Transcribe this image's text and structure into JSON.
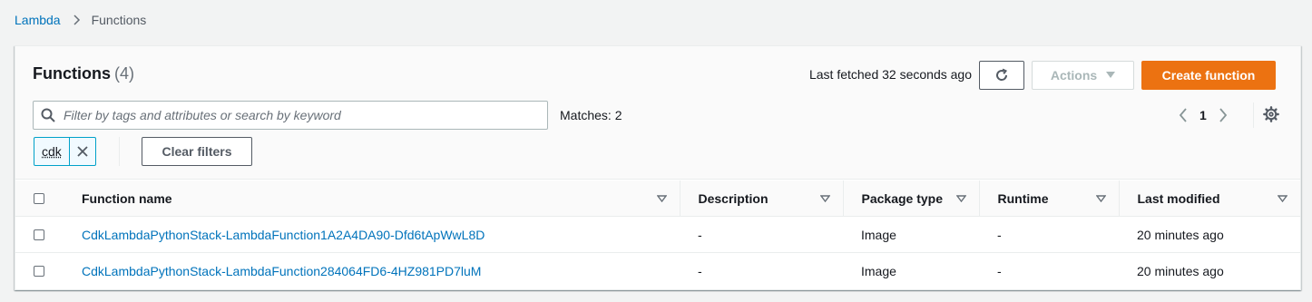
{
  "breadcrumb": {
    "root": "Lambda",
    "current": "Functions"
  },
  "header": {
    "title": "Functions",
    "count": "(4)",
    "last_fetched": "Last fetched 32 seconds ago",
    "actions_label": "Actions",
    "create_label": "Create function"
  },
  "filter": {
    "placeholder": "Filter by tags and attributes or search by keyword",
    "matches": "Matches: 2",
    "token": "cdk",
    "clear_label": "Clear filters"
  },
  "pagination": {
    "page": "1"
  },
  "table": {
    "columns": [
      "Function name",
      "Description",
      "Package type",
      "Runtime",
      "Last modified"
    ],
    "rows": [
      {
        "name": "CdkLambdaPythonStack-LambdaFunction1A2A4DA90-Dfd6tApWwL8D",
        "description": "-",
        "package_type": "Image",
        "runtime": "-",
        "last_modified": "20 minutes ago"
      },
      {
        "name": "CdkLambdaPythonStack-LambdaFunction284064FD6-4HZ981PD7luM",
        "description": "-",
        "package_type": "Image",
        "runtime": "-",
        "last_modified": "20 minutes ago"
      }
    ]
  },
  "colors": {
    "link": "#0073bb",
    "primary": "#ec7211",
    "token_border": "#00a1c9"
  }
}
